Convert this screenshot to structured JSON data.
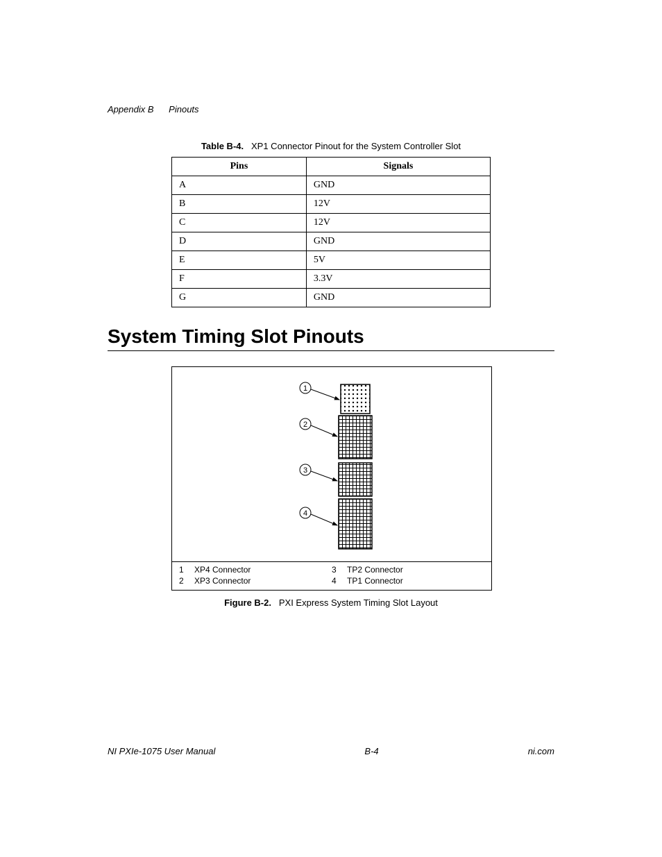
{
  "header": {
    "appendix": "Appendix B",
    "section": "Pinouts"
  },
  "table": {
    "caption_label": "Table B-4.",
    "caption_text": "XP1 Connector Pinout for the System Controller Slot",
    "col_pins": "Pins",
    "col_signals": "Signals",
    "rows": [
      {
        "pin": "A",
        "signal": "GND"
      },
      {
        "pin": "B",
        "signal": "12V"
      },
      {
        "pin": "C",
        "signal": "12V"
      },
      {
        "pin": "D",
        "signal": "GND"
      },
      {
        "pin": "E",
        "signal": "5V"
      },
      {
        "pin": "F",
        "signal": "3.3V"
      },
      {
        "pin": "G",
        "signal": "GND"
      }
    ]
  },
  "section_title": "System Timing Slot Pinouts",
  "figure": {
    "callouts": [
      "1",
      "2",
      "3",
      "4"
    ],
    "legend": [
      {
        "num": "1",
        "text": "XP4 Connector"
      },
      {
        "num": "2",
        "text": "XP3 Connector"
      },
      {
        "num": "3",
        "text": "TP2 Connector"
      },
      {
        "num": "4",
        "text": "TP1 Connector"
      }
    ],
    "caption_label": "Figure B-2.",
    "caption_text": "PXI Express System Timing Slot Layout"
  },
  "footer": {
    "left": "NI PXIe-1075 User Manual",
    "center": "B-4",
    "right": "ni.com"
  }
}
